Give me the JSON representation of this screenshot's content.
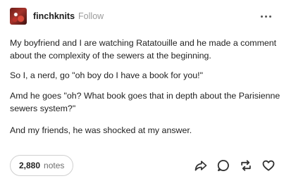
{
  "post": {
    "username": "finchknits",
    "follow_label": "Follow",
    "paragraphs": [
      "My boyfriend and I are watching Ratatouille and he made a comment about the complexity of the sewers at the beginning.",
      "So I, a nerd, go \"oh boy do I have a book for you!\"",
      "Amd he goes \"oh? What book goes that in depth about the Parisienne sewers system?\"",
      "And my friends, he was shocked at my answer."
    ],
    "notes_count": "2,880",
    "notes_label": "notes"
  },
  "icons": {
    "more": "more-options-icon",
    "share": "share-icon",
    "reply": "reply-icon",
    "reblog": "reblog-icon",
    "like": "heart-icon"
  },
  "colors": {
    "text": "#222222",
    "muted": "#9b9b9b",
    "border": "#d0d0d0"
  }
}
